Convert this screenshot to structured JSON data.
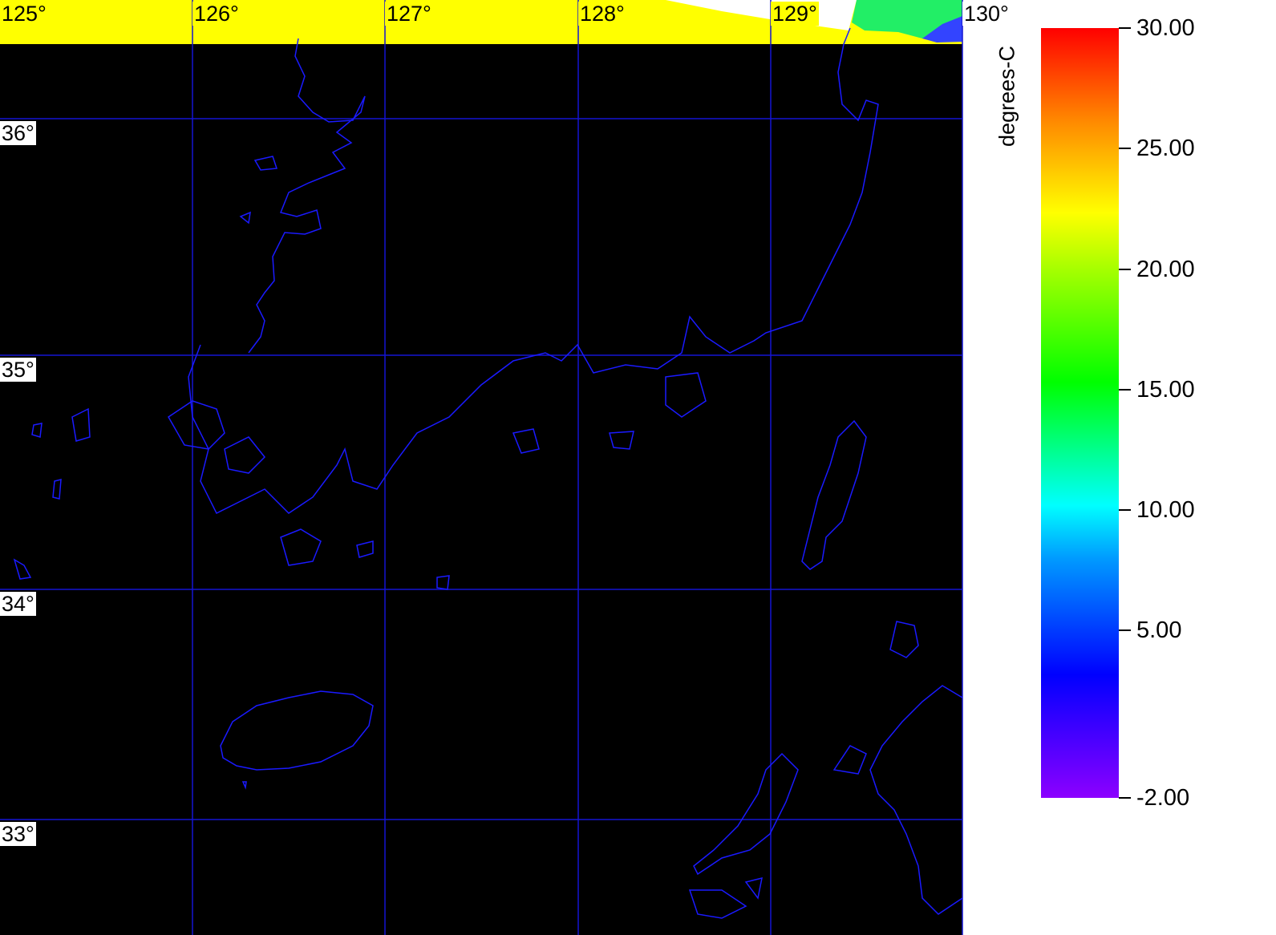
{
  "map": {
    "background_color": "#000000",
    "missing_data_color": "#ffff00",
    "coastline_color": "#1a1aff",
    "grid_color": "#1414d2",
    "lon_labels": [
      "125°",
      "126°",
      "127°",
      "128°",
      "129°",
      "130°"
    ],
    "lat_labels": [
      "36°",
      "35°",
      "34°",
      "33°"
    ]
  },
  "colorbar": {
    "title": "degrees-C",
    "tick_labels": [
      "30.00",
      "25.00",
      "20.00",
      "15.00",
      "10.00",
      "5.00",
      "-2.00"
    ],
    "min": -2,
    "max": 30,
    "colors": [
      "#8c00ff",
      "#0000ff",
      "#00ffff",
      "#00ff00",
      "#ffff00",
      "#ff7f00",
      "#ff0000"
    ]
  }
}
